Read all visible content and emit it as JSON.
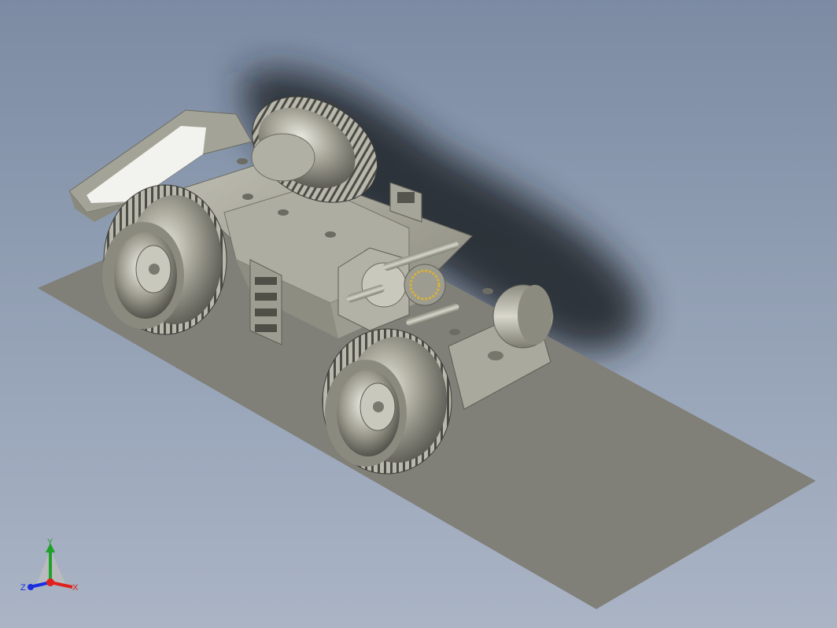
{
  "triad": {
    "x_label": "X",
    "y_label": "Y",
    "z_label": "Z",
    "x_color": "#e0201c",
    "y_color": "#1fa12a",
    "z_color": "#1a2ee0"
  },
  "scene": {
    "background_top": "#7c8ba3",
    "background_bottom": "#aab4c5",
    "ground_color": "#807f78",
    "model_color": "#a7a699",
    "shadow_color": "#1c2026",
    "gear_accent": "#d9b238"
  }
}
